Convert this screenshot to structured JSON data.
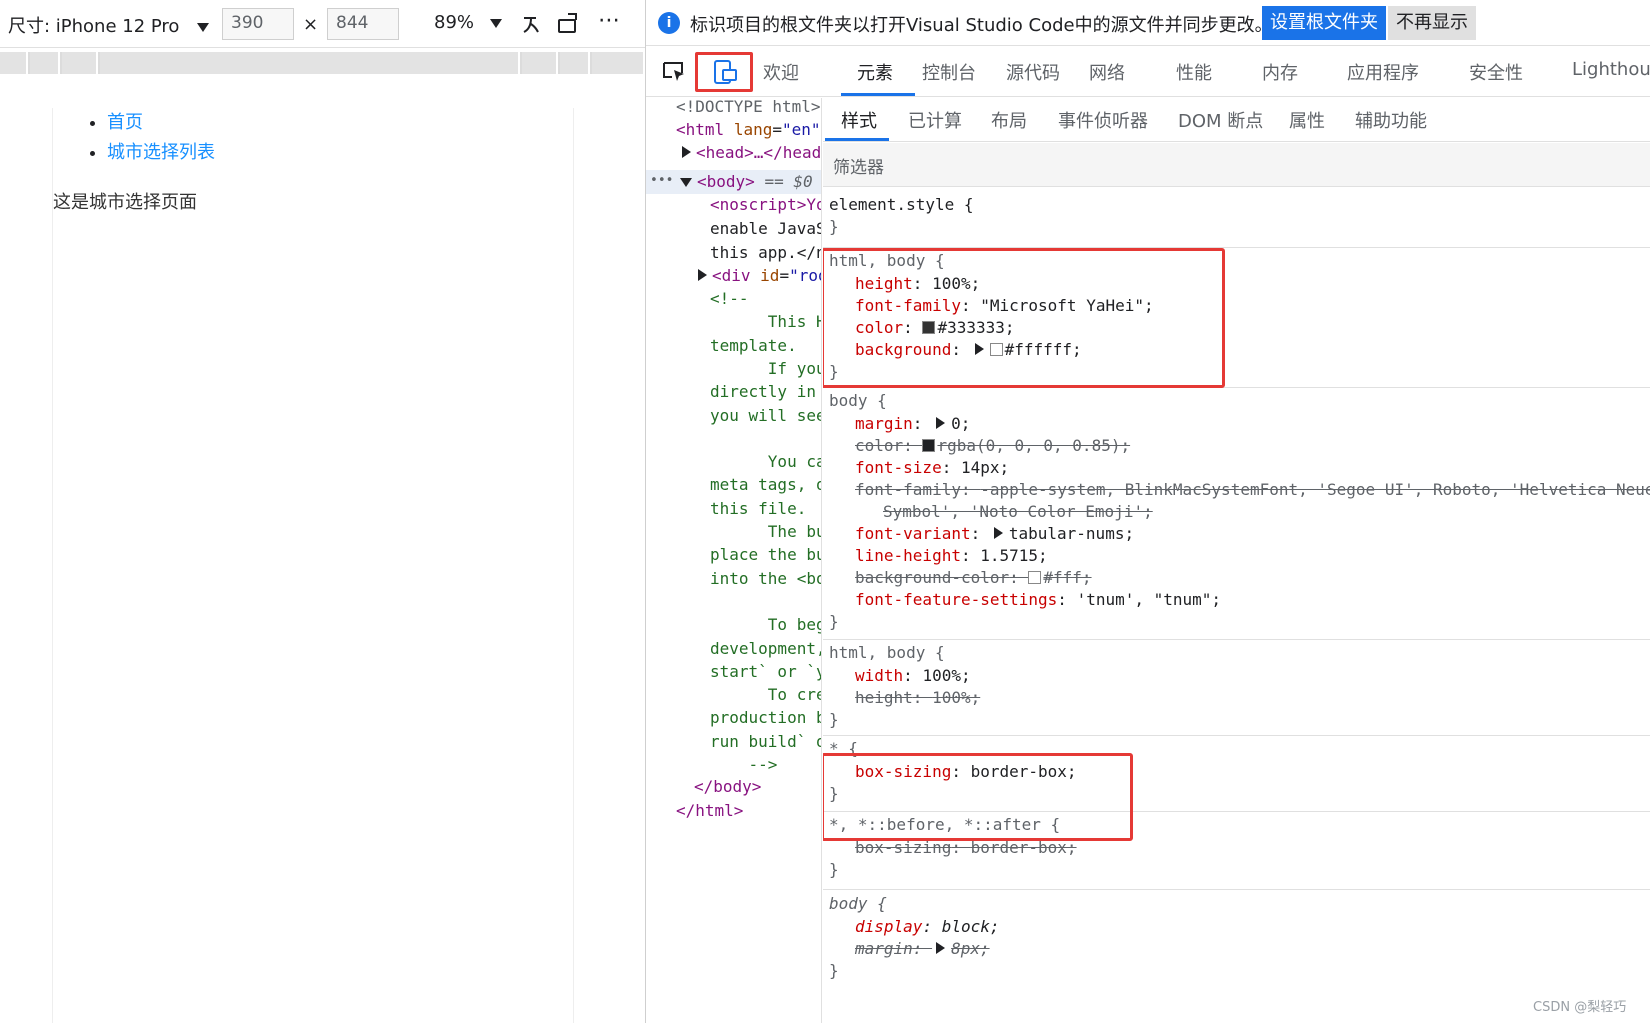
{
  "device_toolbar": {
    "dimensions_label": "尺寸: iPhone 12 Pro",
    "width_value": "390",
    "times": "×",
    "height_value": "844",
    "zoom": "89%",
    "more": "⋯"
  },
  "page": {
    "nav_items": [
      "首页",
      "城市选择列表"
    ],
    "text": "这是城市选择页面"
  },
  "infobar": {
    "icon": "i",
    "message": "标识项目的根文件夹以打开Visual Studio Code中的源文件并同步更改。",
    "set_root_button": "设置根文件夹",
    "dont_show_button": "不再显示"
  },
  "main_tabs": [
    "欢迎",
    "元素",
    "控制台",
    "源代码",
    "网络",
    "性能",
    "内存",
    "应用程序",
    "安全性",
    "Lighthouse"
  ],
  "active_main_tab": "元素",
  "dom": {
    "doctype": "<!DOCTYPE html>",
    "html_open": "<html",
    "html_lang_attr": "lang",
    "html_lang_val": "\"en\"",
    "head": "<head>…</head>",
    "body": "<body>",
    "body_eq": "== $0",
    "noscript": "<noscript>You need to",
    "noscript_2": "enable JavaScript to run",
    "noscript_3": "this app.</noscript>",
    "div": "<div",
    "div_attr": "id",
    "div_val": "\"root\"",
    "comment_lines": [
      "<!--",
      "      This HTML file is a",
      "template.",
      "      If you open it",
      "directly in the browser,",
      "you will see an empty page.",
      "",
      "      You can add webfonts,",
      "meta tags, or analytics to",
      "this file.",
      "      The build step will",
      "place the bundled scripts",
      "into the <body> tag.",
      "",
      "      To begin the",
      "development, run `npm",
      "start` or `yarn start`.",
      "      To create a",
      "production bundle, use `npm",
      "run build` or `yarn build`.",
      "    -->"
    ],
    "body_close": "</body>",
    "html_close": "</html>",
    "row_dots": "•••"
  },
  "styles_tabs": [
    "样式",
    "已计算",
    "布局",
    "事件侦听器",
    "DOM 断点",
    "属性",
    "辅助功能"
  ],
  "filter_placeholder": "筛选器",
  "rules": {
    "element_style": "element.style {",
    "close": "}",
    "r1_sel": "html, body {",
    "r1_height": "height",
    "r1_height_v": "100%;",
    "r1_font": "font-family",
    "r1_font_v": "\"Microsoft YaHei\";",
    "r1_color": "color",
    "r1_color_v": "#333333;",
    "r1_bg": "background",
    "r1_bg_v": "#ffffff;",
    "r2_sel": "body {",
    "r2_margin": "margin",
    "r2_margin_v": "0;",
    "r2_color": "color",
    "r2_color_v": "rgba(0, 0, 0, 0.85);",
    "r2_fs": "font-size",
    "r2_fs_v": "14px;",
    "r2_ff": "font-family",
    "r2_ff_v": "-apple-system, BlinkMacSystemFont, 'Segoe UI', Roboto, 'Helvetica Neue', Arial, 'Noto Sans', sans-serif, 'Apple Color Emoji', 'Segoe UI Emoji', 'Segoe UI",
    "r2_ff_v2": "Symbol', 'Noto Color Emoji';",
    "r2_fv": "font-variant",
    "r2_fv_v": "tabular-nums;",
    "r2_lh": "line-height",
    "r2_lh_v": "1.5715;",
    "r2_bgc": "background-color",
    "r2_bgc_v": "#fff;",
    "r2_ffs": "font-feature-settings",
    "r2_ffs_v": "'tnum', \"tnum\";",
    "r3_sel": "html, body {",
    "r3_width": "width",
    "r3_width_v": "100%;",
    "r3_height": "height",
    "r3_height_v": "100%;",
    "r4_sel": "* {",
    "r4_bs": "box-sizing",
    "r4_bs_v": "border-box;",
    "r5_sel": "*, *::before, *::after {",
    "r5_bs": "box-sizing",
    "r5_bs_v": "border-box;",
    "r6_sel": "body {",
    "r6_display": "display",
    "r6_display_v": "block;",
    "r6_margin": "margin",
    "r6_margin_v": "8px;"
  },
  "watermark": "CSDN @梨轻巧",
  "colors": {
    "accent": "#1a73e8",
    "highlight_box": "#e53935",
    "link": "#1890ff"
  }
}
